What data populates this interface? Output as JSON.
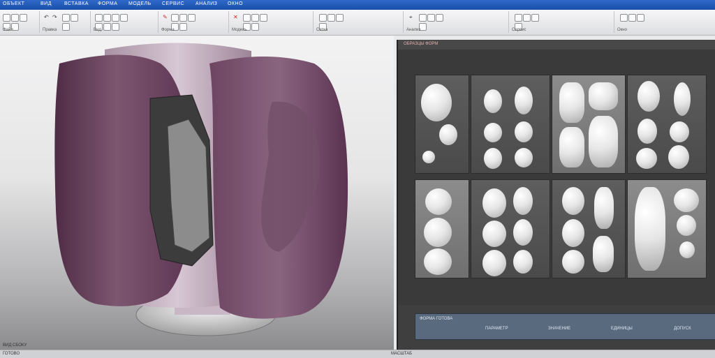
{
  "titlebar": {
    "items": [
      "ОБЪЕКТ",
      "ВИД",
      "ВСТАВКА",
      "ФОРМА",
      "МОДЕЛЬ",
      "СЕРВИС",
      "АНАЛИЗ",
      "ОКНО"
    ]
  },
  "ribbon": {
    "groups": [
      {
        "label": "Файл"
      },
      {
        "label": "Правка"
      },
      {
        "label": "Вид"
      },
      {
        "label": "Форма"
      },
      {
        "label": "Модель"
      },
      {
        "label": "Сетка"
      },
      {
        "label": "Анализ"
      },
      {
        "label": "Сервис"
      },
      {
        "label": "Окно"
      }
    ]
  },
  "viewport": {
    "label": "ВИД СБОКУ"
  },
  "panel": {
    "title": "ОБРАЗЦЫ ФОРМ"
  },
  "footer": {
    "caption": "ФОРМА ГОТОВА",
    "fields": [
      "ПАРАМЕТР",
      "ЗНАЧЕНИЕ",
      "ЕДИНИЦЫ",
      "ДОПУСК"
    ]
  },
  "statusbar": {
    "left": "ГОТОВО",
    "right": "МАСШТАБ"
  }
}
